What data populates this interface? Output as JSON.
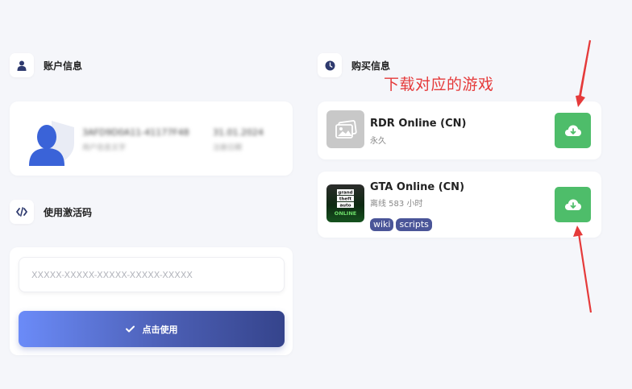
{
  "account": {
    "title": "账户信息",
    "user_id": "3AFD9D0A11-41177F48",
    "user_sub": "用户信息文字",
    "date": "31.01.2024",
    "date_sub": "注册日期"
  },
  "activation": {
    "title": "使用激活码",
    "placeholder": "XXXXX-XXXXX-XXXXX-XXXXX-XXXXX",
    "button_label": "点击使用"
  },
  "purchases": {
    "title": "购买信息",
    "annotation": "下载对应的游戏",
    "games": [
      {
        "name": "RDR Online (CN)",
        "subtitle": "永久",
        "tags": []
      },
      {
        "name": "GTA Online (CN)",
        "subtitle": "离线 583 小时",
        "thumb_text": [
          "grand",
          "theft",
          "auto",
          "ONLINE"
        ],
        "tags": [
          "wiki",
          "scripts"
        ]
      }
    ]
  },
  "colors": {
    "accent_blue": "#4c5fb5",
    "download_green": "#4ebd6a",
    "tag_bg": "#4a5598",
    "annotation_red": "#e53a3a",
    "avatar_blue": "#3a63d8"
  },
  "icons": {
    "account": "user-icon",
    "activation": "code-icon",
    "purchases": "clock-icon",
    "download": "cloud-download-icon"
  }
}
